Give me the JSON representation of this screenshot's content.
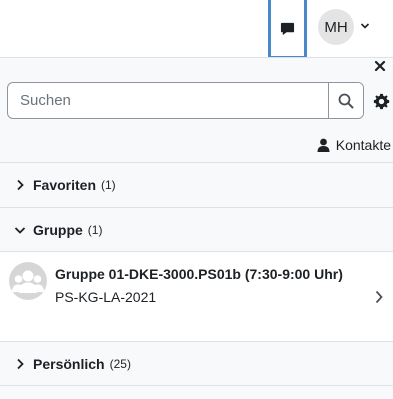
{
  "header": {
    "message_icon": "chat-bubble-icon",
    "user_initials": "MH",
    "user_menu_icon": "chevron-down-icon"
  },
  "drawer": {
    "close_icon": "close-icon",
    "search": {
      "placeholder": "Suchen",
      "button_icon": "search-icon"
    },
    "settings_icon": "gear-icon",
    "contacts": {
      "icon": "user-icon",
      "label": "Kontakte"
    },
    "sections": [
      {
        "label": "Favoriten",
        "count": "(1)",
        "expanded": false
      },
      {
        "label": "Gruppe",
        "count": "(1)",
        "expanded": true
      },
      {
        "label": "Persönlich",
        "count": "(25)",
        "expanded": false
      }
    ],
    "group_conversation": {
      "avatar_icon": "group-icon",
      "title": "Gruppe 01-DKE-3000.PS01b (7:30-9:00 Uhr)",
      "subtitle": "PS-KG-LA-2021"
    }
  },
  "colors": {
    "focus_border": "#4a89c7",
    "drawer_bg": "#f8f9fa",
    "avatar_bg": "#e4e4e4"
  }
}
